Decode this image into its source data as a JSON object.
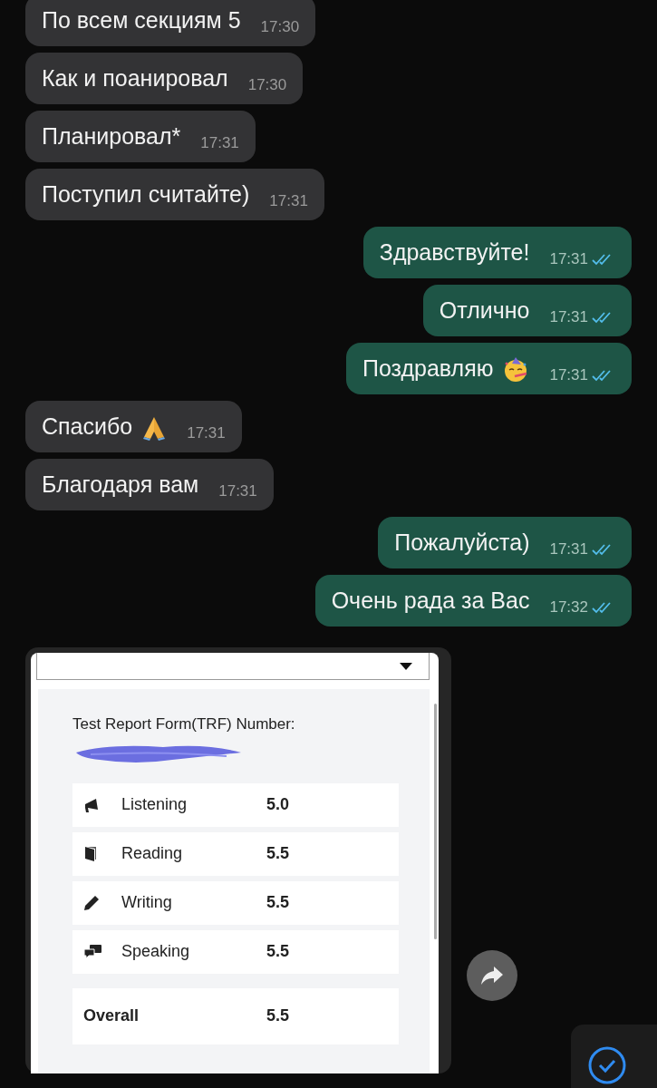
{
  "messages": [
    {
      "kind": "text",
      "outgoing": false,
      "text": "По всем секциям 5",
      "time": "17:30"
    },
    {
      "kind": "text",
      "outgoing": false,
      "text": "Как и поанировал",
      "time": "17:30"
    },
    {
      "kind": "text",
      "outgoing": false,
      "text": "Планировал*",
      "time": "17:31"
    },
    {
      "kind": "text",
      "outgoing": false,
      "text": "Поступил считайте)",
      "time": "17:31"
    },
    {
      "kind": "text",
      "outgoing": true,
      "text": "Здравствуйте!",
      "time": "17:31",
      "read": true
    },
    {
      "kind": "text",
      "outgoing": true,
      "text": "Отлично",
      "time": "17:31",
      "read": true
    },
    {
      "kind": "party",
      "outgoing": true,
      "text": "Поздравляю",
      "time": "17:31",
      "read": true
    },
    {
      "kind": "prayer",
      "outgoing": false,
      "text": "Спасибо",
      "time": "17:31"
    },
    {
      "kind": "text",
      "outgoing": false,
      "text": "Благодаря вам",
      "time": "17:31"
    },
    {
      "kind": "text",
      "outgoing": true,
      "text": "Пожалуйста)",
      "time": "17:31",
      "read": true
    },
    {
      "kind": "text",
      "outgoing": true,
      "text": "Очень рада за Вас",
      "time": "17:32",
      "read": true
    },
    {
      "kind": "image",
      "outgoing": false,
      "report": {
        "title": "Test Report Form(TRF) Number:",
        "rows": [
          {
            "label": "Listening",
            "score": "5.0"
          },
          {
            "label": "Reading",
            "score": "5.5"
          },
          {
            "label": "Writing",
            "score": "5.5"
          },
          {
            "label": "Speaking",
            "score": "5.5"
          }
        ],
        "overall": {
          "label": "Overall",
          "score": "5.5"
        }
      }
    }
  ]
}
